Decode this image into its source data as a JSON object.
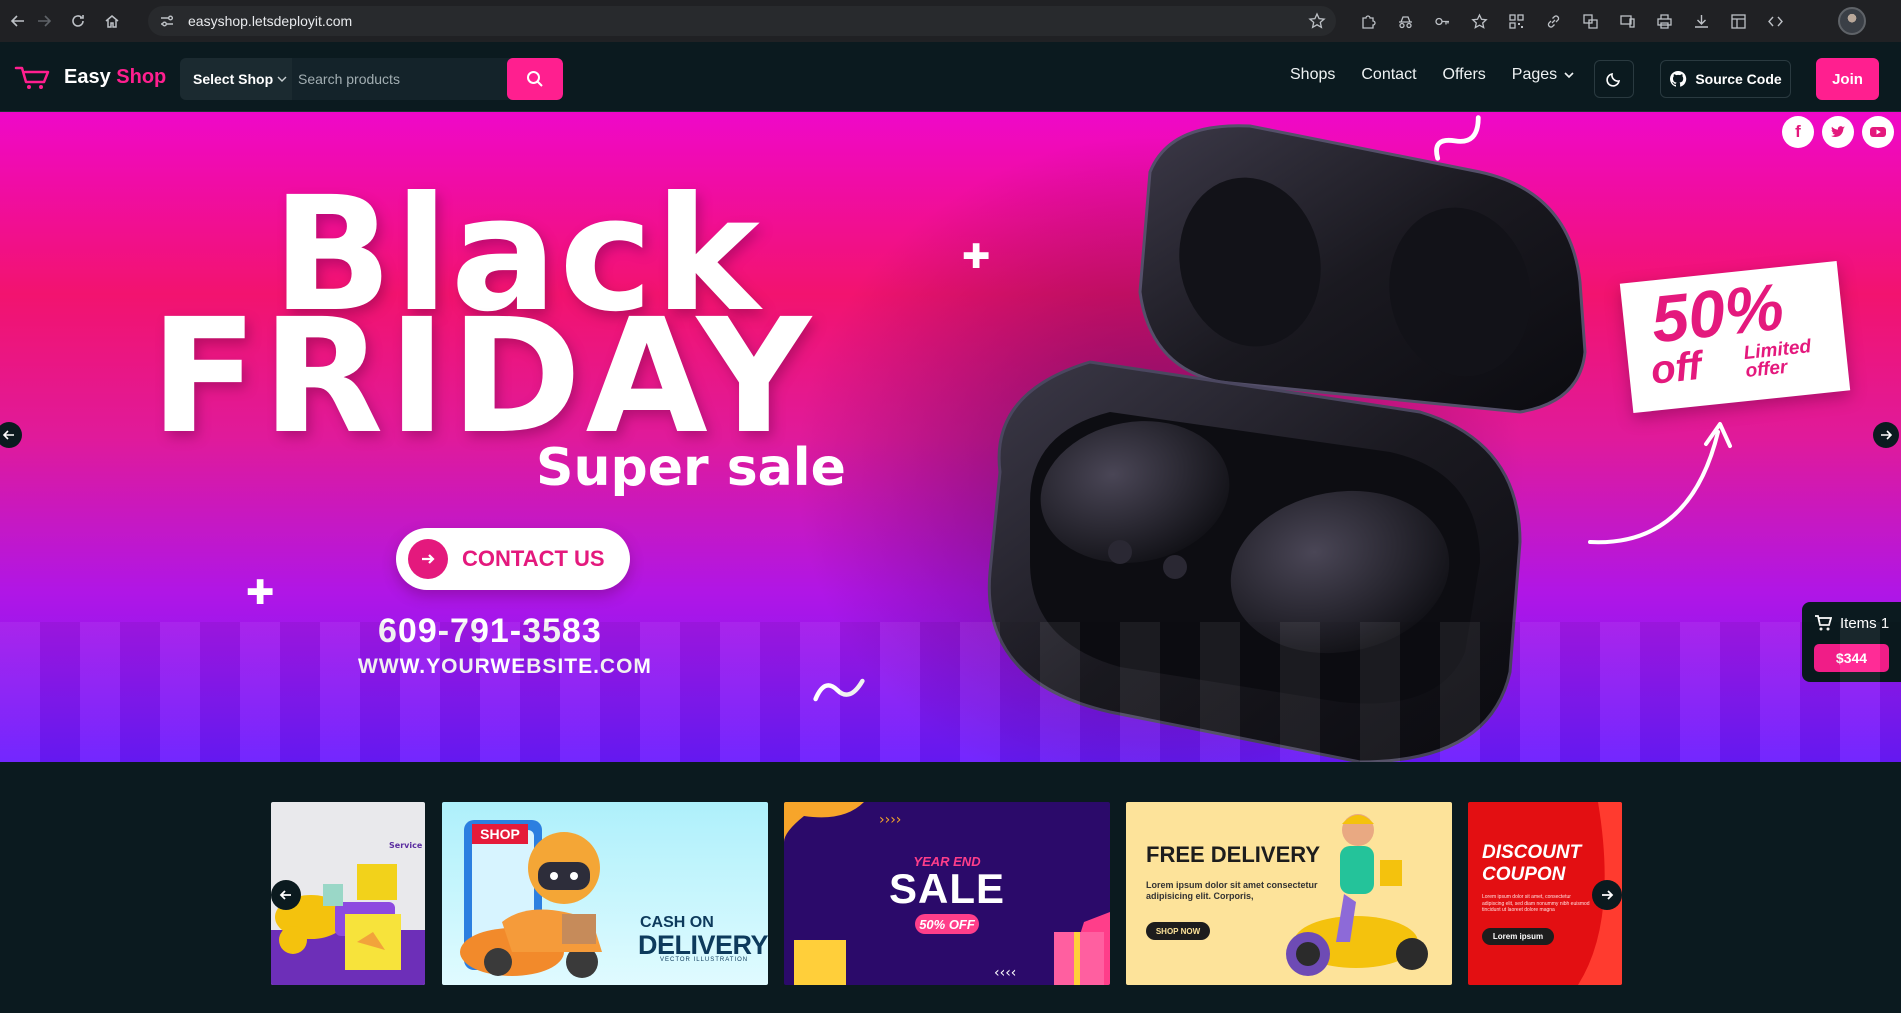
{
  "browser": {
    "url": "easyshop.letsdeployit.com"
  },
  "header": {
    "logo_word1": "Easy",
    "logo_word2": "Shop",
    "shop_select": "Select Shop",
    "search_placeholder": "Search products",
    "nav": [
      "Shops",
      "Contact",
      "Offers",
      "Pages"
    ],
    "source_code": "Source Code",
    "join": "Join",
    "accent_color": "#ff1f8f"
  },
  "hero": {
    "title_line1": "Black",
    "title_line2": "FRIDAY",
    "subtitle": "Super sale",
    "cta": "CONTACT US",
    "phone": "609-791-3583",
    "website": "WWW.YOURWEBSITE.COM",
    "offer_percent": "50%",
    "offer_off": "off",
    "offer_limited": "Limited offer",
    "social": [
      "facebook-icon",
      "twitter-icon",
      "youtube-icon"
    ]
  },
  "cart": {
    "items_label": "Items 1",
    "total": "$344"
  },
  "promos": {
    "shop_tag": "SHOP",
    "cash_on": "CASH ON",
    "delivery": "DELIVERY",
    "vector_illustration": "VECTOR ILLUSTRATION",
    "year_end": "YEAR END",
    "sale": "SALE",
    "sale_pct": "50% OFF",
    "free_delivery": "FREE DELIVERY",
    "free_delivery_body": "Lorem ipsum dolor sit amet consectetur adipisicing elit. Corporis,",
    "shop_now": "SHOP NOW",
    "discount_title": "DISCOUNT COUPON",
    "discount_body": "Lorem ipsum dolor sit amet, consectetur adipiscing elit, sed diam nonummy nibh euismod tincidunt ut laoreet dolore magna",
    "discount_btn": "Lorem ipsum",
    "service_logo": "Service"
  }
}
